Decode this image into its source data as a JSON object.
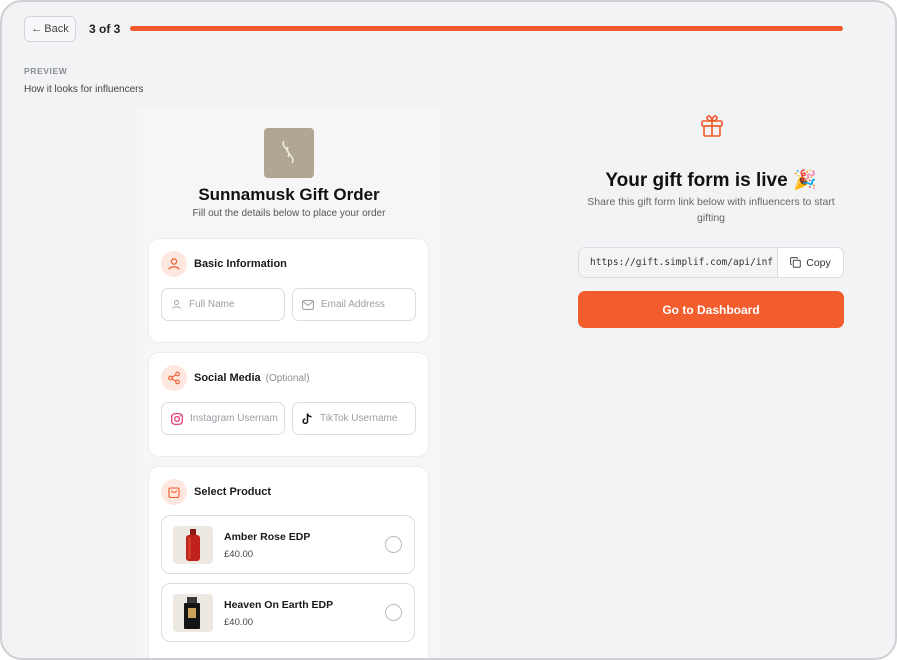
{
  "header": {
    "back_label": "Back",
    "step_text": "3 of 3",
    "progress_fraction": 1.0
  },
  "preview": {
    "label": "PREVIEW",
    "subtitle": "How it looks for influencers"
  },
  "form": {
    "title": "Sunnamusk Gift Order",
    "subtitle": "Fill out the details below to place your order",
    "basic": {
      "title": "Basic Information",
      "full_name_placeholder": "Full Name",
      "email_placeholder": "Email Address"
    },
    "social": {
      "title": "Social Media",
      "optional_label": "(Optional)",
      "instagram_placeholder": "Instagram Usernam",
      "tiktok_placeholder": "TikTok Username"
    },
    "products": {
      "title": "Select Product",
      "items": [
        {
          "name": "Amber Rose EDP",
          "price": "£40.00"
        },
        {
          "name": "Heaven On Earth EDP",
          "price": "£40.00"
        }
      ]
    }
  },
  "live": {
    "title": "Your gift form is live",
    "emoji": "🎉",
    "description": "Share this gift form link below with influencers to start gifting",
    "url": "https://gift.simplif.com/api/inf",
    "copy_label": "Copy",
    "dashboard_label": "Go to Dashboard"
  },
  "colors": {
    "accent": "#f35c2c",
    "background": "#f2f3f5",
    "logo_bg": "#b0a792"
  }
}
